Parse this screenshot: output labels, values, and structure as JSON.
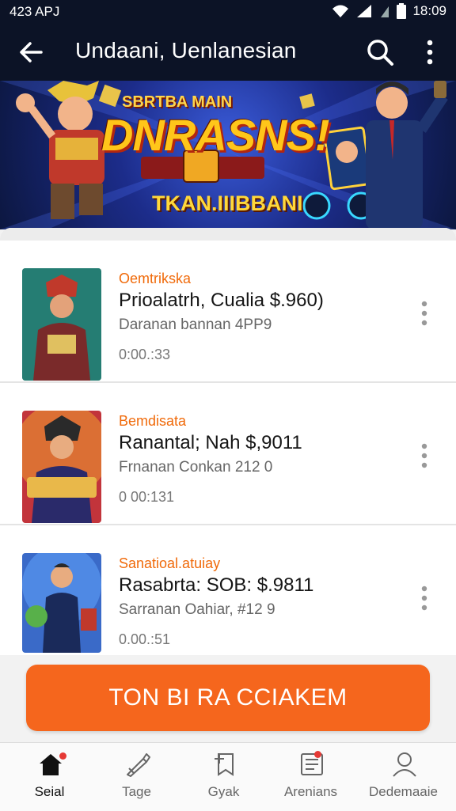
{
  "status_bar": {
    "time": "423 APJ",
    "clock": "18:09"
  },
  "app_bar": {
    "title": "Undaani, Uenlanesian"
  },
  "banner": {
    "kicker": "SBRTBA MAIN",
    "headline": "DNRASNS!",
    "tagline": "TKAN.IIIBBANI",
    "plaque": ""
  },
  "items": [
    {
      "category": "Oemtrikska",
      "name": "Prioalatrh, Cualia $.960)",
      "subtitle": "Daranan bannan 4PP9",
      "duration": "0:00.:33"
    },
    {
      "category": "Bemdisata",
      "name": "Ranantal; Nah $,9011",
      "subtitle": "Frnanan Conkan 212 0",
      "duration": "0  00:131"
    },
    {
      "category": "Sanatioal.atuiay",
      "name": "Rasabrta: SOB: $.9811",
      "subtitle": "Sarranan Oahiar, #12 9",
      "duration": "0.00.:51"
    }
  ],
  "cta": {
    "label": "TON BI RA CCIAKEM"
  },
  "nav": [
    {
      "label": "Seial",
      "icon": "home-icon",
      "active": true
    },
    {
      "label": "Tage",
      "icon": "tag-pen-icon",
      "active": false
    },
    {
      "label": "Gyak",
      "icon": "bookmark-edit-icon",
      "active": false
    },
    {
      "label": "Arenians",
      "icon": "document-icon",
      "active": false
    },
    {
      "label": "Dedemaaie",
      "icon": "person-icon",
      "active": false
    }
  ],
  "colors": {
    "accent": "#f5661d",
    "header_bg": "#0c1326",
    "category_text": "#f06a0a",
    "badge": "#e53935"
  }
}
